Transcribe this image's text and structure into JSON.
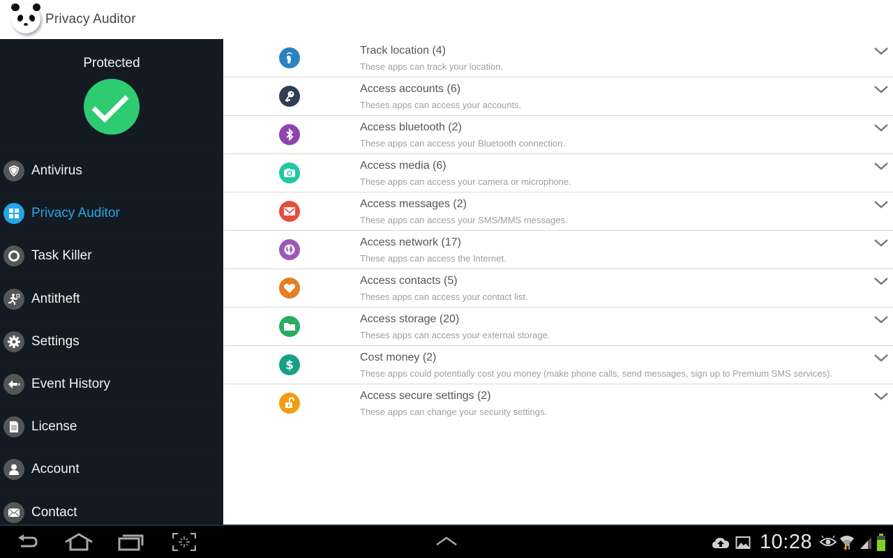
{
  "header": {
    "app_title": "Privacy Auditor",
    "logo_icon": "panda-logo-icon"
  },
  "sidebar": {
    "status_label": "Protected",
    "status_icon": "checkmark-icon",
    "status_color": "#2ecc71",
    "active_color": "#27a7e6",
    "items": [
      {
        "label": "Antivirus",
        "icon": "shield-icon",
        "active": false
      },
      {
        "label": "Privacy Auditor",
        "icon": "grid-icon",
        "active": true
      },
      {
        "label": "Task Killer",
        "icon": "target-icon",
        "active": false
      },
      {
        "label": "Antitheft",
        "icon": "running-thief-icon",
        "active": false
      },
      {
        "label": "Settings",
        "icon": "gear-icon",
        "active": false
      },
      {
        "label": "Event History",
        "icon": "arrow-left-icon",
        "active": false
      },
      {
        "label": "License",
        "icon": "document-icon",
        "active": false
      },
      {
        "label": "Account",
        "icon": "user-icon",
        "active": false
      },
      {
        "label": "Contact",
        "icon": "envelope-icon",
        "active": false
      }
    ]
  },
  "permissions": [
    {
      "title": "Track location (4)",
      "description": "These apps can track your location.",
      "icon": "footprint-icon",
      "color": "#2a82c2"
    },
    {
      "title": "Access accounts (6)",
      "description": "Theses apps can access your accounts.",
      "icon": "key-icon",
      "color": "#2f3e50"
    },
    {
      "title": "Access bluetooth (2)",
      "description": "These apps can access your Bluetooth connection.",
      "icon": "bluetooth-icon",
      "color": "#8e44ad"
    },
    {
      "title": "Access media (6)",
      "description": "These apps can access your camera or microphone.",
      "icon": "camera-icon",
      "color": "#1fc9a4"
    },
    {
      "title": "Access messages (2)",
      "description": "These apps can access your SMS/MMS messages.",
      "icon": "envelope-icon",
      "color": "#e74c3c"
    },
    {
      "title": "Access network (17)",
      "description": "These apps can access the Internet.",
      "icon": "globe-icon",
      "color": "#9b59b6"
    },
    {
      "title": "Access contacts (5)",
      "description": "Theses apps can access your contact list.",
      "icon": "heart-icon",
      "color": "#e67e22"
    },
    {
      "title": "Access storage (20)",
      "description": "Theses apps can access your external storage.",
      "icon": "folder-icon",
      "color": "#27ae60"
    },
    {
      "title": "Cost money (2)",
      "description": "These apps could potentially cost you money (make phone calls, send messages, sign up to Premium SMS services).",
      "icon": "dollar-icon",
      "color": "#16a085"
    },
    {
      "title": "Access secure settings (2)",
      "description": "These apps can change your security settings.",
      "icon": "unlock-icon",
      "color": "#f39c12"
    }
  ],
  "system_bar": {
    "buttons": [
      "back",
      "home",
      "recent-apps",
      "screenshot"
    ],
    "clock": "10:28",
    "battery_color": "#7ed321"
  }
}
